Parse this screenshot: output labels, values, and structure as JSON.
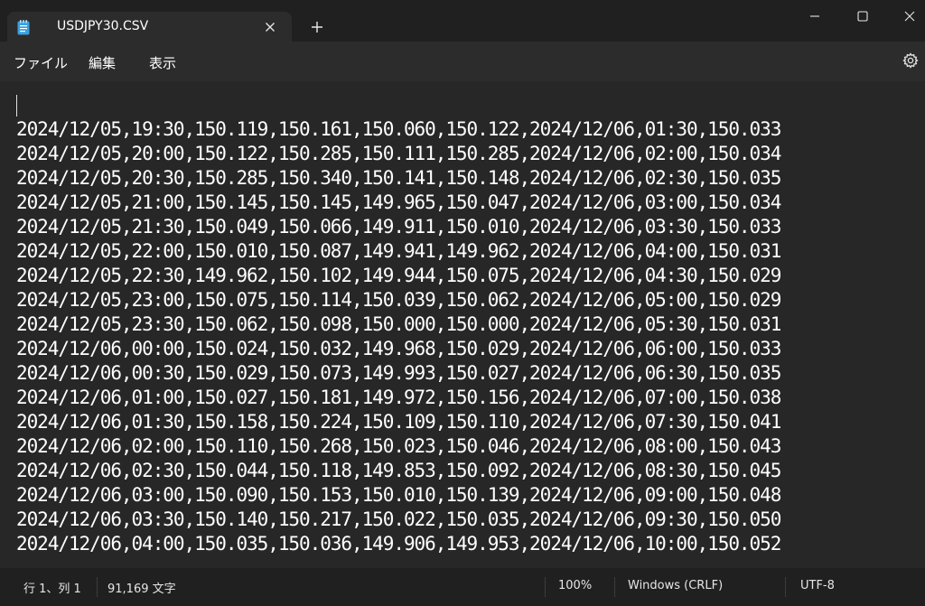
{
  "window": {
    "tab_title": "USDJPY30.CSV",
    "new_tab": "+",
    "icons": {
      "app": "notepad-icon",
      "close_tab": "close-icon",
      "minimize": "minimize-icon",
      "maximize": "maximize-icon",
      "close": "close-icon",
      "settings": "gear-icon"
    }
  },
  "menu": {
    "file": "ファイル",
    "edit": "編集",
    "view": "表示"
  },
  "editor": {
    "lines": [
      "2024/12/05,19:30,150.119,150.161,150.060,150.122,2024/12/06,01:30,150.033",
      "2024/12/05,20:00,150.122,150.285,150.111,150.285,2024/12/06,02:00,150.034",
      "2024/12/05,20:30,150.285,150.340,150.141,150.148,2024/12/06,02:30,150.035",
      "2024/12/05,21:00,150.145,150.145,149.965,150.047,2024/12/06,03:00,150.034",
      "2024/12/05,21:30,150.049,150.066,149.911,150.010,2024/12/06,03:30,150.033",
      "2024/12/05,22:00,150.010,150.087,149.941,149.962,2024/12/06,04:00,150.031",
      "2024/12/05,22:30,149.962,150.102,149.944,150.075,2024/12/06,04:30,150.029",
      "2024/12/05,23:00,150.075,150.114,150.039,150.062,2024/12/06,05:00,150.029",
      "2024/12/05,23:30,150.062,150.098,150.000,150.000,2024/12/06,05:30,150.031",
      "2024/12/06,00:00,150.024,150.032,149.968,150.029,2024/12/06,06:00,150.033",
      "2024/12/06,00:30,150.029,150.073,149.993,150.027,2024/12/06,06:30,150.035",
      "2024/12/06,01:00,150.027,150.181,149.972,150.156,2024/12/06,07:00,150.038",
      "2024/12/06,01:30,150.158,150.224,150.109,150.110,2024/12/06,07:30,150.041",
      "2024/12/06,02:00,150.110,150.268,150.023,150.046,2024/12/06,08:00,150.043",
      "2024/12/06,02:30,150.044,150.118,149.853,150.092,2024/12/06,08:30,150.045",
      "2024/12/06,03:00,150.090,150.153,150.010,150.139,2024/12/06,09:00,150.048",
      "2024/12/06,03:30,150.140,150.217,150.022,150.035,2024/12/06,09:30,150.050",
      "2024/12/06,04:00,150.035,150.036,149.906,149.953,2024/12/06,10:00,150.052"
    ]
  },
  "status": {
    "position": "行 1、列 1",
    "char_count": "91,169 文字",
    "zoom": "100%",
    "line_ending": "Windows (CRLF)",
    "encoding": "UTF-8"
  },
  "colors": {
    "background": "#272727",
    "chrome": "#202020",
    "text": "#ffffff",
    "app_icon": "#3aa0e0"
  }
}
